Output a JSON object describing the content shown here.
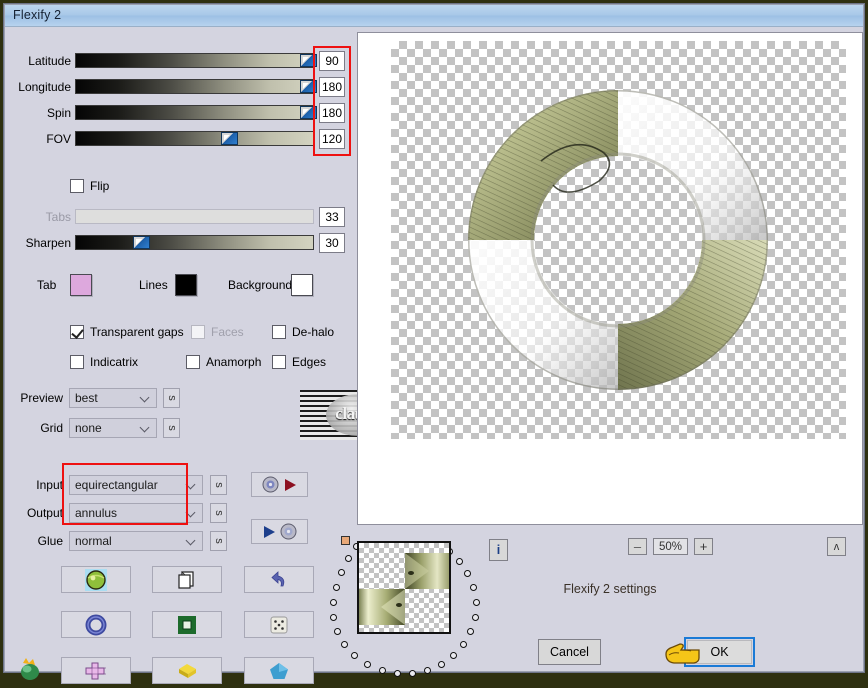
{
  "window": {
    "title": "Flexify 2"
  },
  "sliders": [
    {
      "label": "Latitude",
      "value": "90",
      "pct": 99,
      "disabled": false
    },
    {
      "label": "Longitude",
      "value": "180",
      "pct": 99,
      "disabled": false
    },
    {
      "label": "Spin",
      "value": "180",
      "pct": 99,
      "disabled": false
    },
    {
      "label": "FOV",
      "value": "120",
      "pct": 62,
      "disabled": false
    }
  ],
  "flip": {
    "label": "Flip",
    "checked": false
  },
  "sliders2": [
    {
      "label": "Tabs",
      "value": "33",
      "pct": 0,
      "disabled": true
    },
    {
      "label": "Sharpen",
      "value": "30",
      "pct": 24,
      "disabled": false
    }
  ],
  "colors": {
    "tab_label": "Tab",
    "tab_color": "#dda8dd",
    "lines_label": "Lines",
    "lines_color": "#000000",
    "background_label": "Background",
    "background_color": "#ffffff",
    "highlight_red": "#ee1111",
    "focus_blue": "#1a7ad6"
  },
  "checkboxes": [
    {
      "name": "transparent-gaps",
      "label": "Transparent gaps",
      "checked": true,
      "disabled": false
    },
    {
      "name": "faces",
      "label": "Faces",
      "checked": false,
      "disabled": true
    },
    {
      "name": "de-halo",
      "label": "De-halo",
      "checked": false,
      "disabled": false
    },
    {
      "name": "indicatrix",
      "label": "Indicatrix",
      "checked": false,
      "disabled": false
    },
    {
      "name": "anamorph",
      "label": "Anamorph",
      "checked": false,
      "disabled": false
    },
    {
      "name": "edges",
      "label": "Edges",
      "checked": false,
      "disabled": false
    }
  ],
  "selects": [
    {
      "name": "preview",
      "label": "Preview",
      "value": "best",
      "side_button": "s"
    },
    {
      "name": "grid",
      "label": "Grid",
      "value": "none",
      "side_button": "s"
    },
    {
      "name": "input",
      "label": "Input",
      "value": "equirectangular",
      "side_button": "s"
    },
    {
      "name": "output",
      "label": "Output",
      "value": "annulus",
      "side_button": "s"
    },
    {
      "name": "glue",
      "label": "Glue",
      "value": "normal",
      "side_button": "s"
    }
  ],
  "io_buttons": [
    {
      "name": "load-settings",
      "icon": "disc-play-icon"
    },
    {
      "name": "save-settings",
      "icon": "play-disc-icon"
    }
  ],
  "toolbar_icons": [
    {
      "name": "preset-globe-button",
      "icon": "globe-icon"
    },
    {
      "name": "copy-button",
      "icon": "pages-icon"
    },
    {
      "name": "undo-button",
      "icon": "undo-arrow-icon"
    },
    {
      "name": "ring-button",
      "icon": "torus-icon"
    },
    {
      "name": "square-button",
      "icon": "green-square-icon"
    },
    {
      "name": "random-button",
      "icon": "dice-icon"
    },
    {
      "name": "cross-button",
      "icon": "cross-icon"
    },
    {
      "name": "cube-button",
      "icon": "cube-icon"
    },
    {
      "name": "pentagon-button",
      "icon": "pentagon-icon"
    }
  ],
  "corner_icon": {
    "name": "flame-drop-icon"
  },
  "status": {
    "info_button": "i",
    "zoom_out": "–",
    "zoom_level": "50%",
    "zoom_in": "+",
    "collapse_button": "ʌ",
    "message": "Flexify 2 settings",
    "cancel_label": "Cancel",
    "ok_label": "OK"
  },
  "preview_image": {
    "description": "annulus-render",
    "ring_color_a": "#d9dcae",
    "ring_color_b": "#8a8f5e"
  },
  "watermark": {
    "text": "claudia"
  }
}
